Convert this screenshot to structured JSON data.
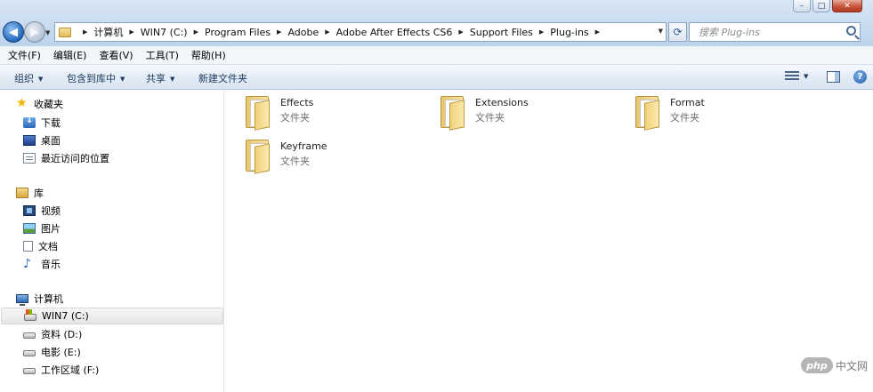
{
  "address": {
    "crumbs": [
      "计算机",
      "WIN7 (C:)",
      "Program Files",
      "Adobe",
      "Adobe After Effects CS6",
      "Support Files",
      "Plug-ins"
    ]
  },
  "search": {
    "placeholder": "搜索 Plug-ins"
  },
  "menu": [
    "文件(F)",
    "编辑(E)",
    "查看(V)",
    "工具(T)",
    "帮助(H)"
  ],
  "commands": {
    "organize": "组织",
    "include_library": "包含到库中",
    "share": "共享",
    "new_folder": "新建文件夹"
  },
  "nav": {
    "favorites": {
      "label": "收藏夹",
      "items": [
        "下载",
        "桌面",
        "最近访问的位置"
      ]
    },
    "libraries": {
      "label": "库",
      "items": [
        "视频",
        "图片",
        "文档",
        "音乐"
      ]
    },
    "computer": {
      "label": "计算机",
      "items": [
        "WIN7 (C:)",
        "资料 (D:)",
        "电影 (E:)",
        "工作区域 (F:)"
      ]
    }
  },
  "folders": [
    {
      "name": "Effects",
      "type": "文件夹"
    },
    {
      "name": "Extensions",
      "type": "文件夹"
    },
    {
      "name": "Format",
      "type": "文件夹"
    },
    {
      "name": "Keyframe",
      "type": "文件夹"
    }
  ],
  "watermark": {
    "logo": "php",
    "text": "中文网"
  },
  "colors": {
    "accent": "#1e395b",
    "selection": "#e6e6e6",
    "folder": "#f1d27a"
  }
}
